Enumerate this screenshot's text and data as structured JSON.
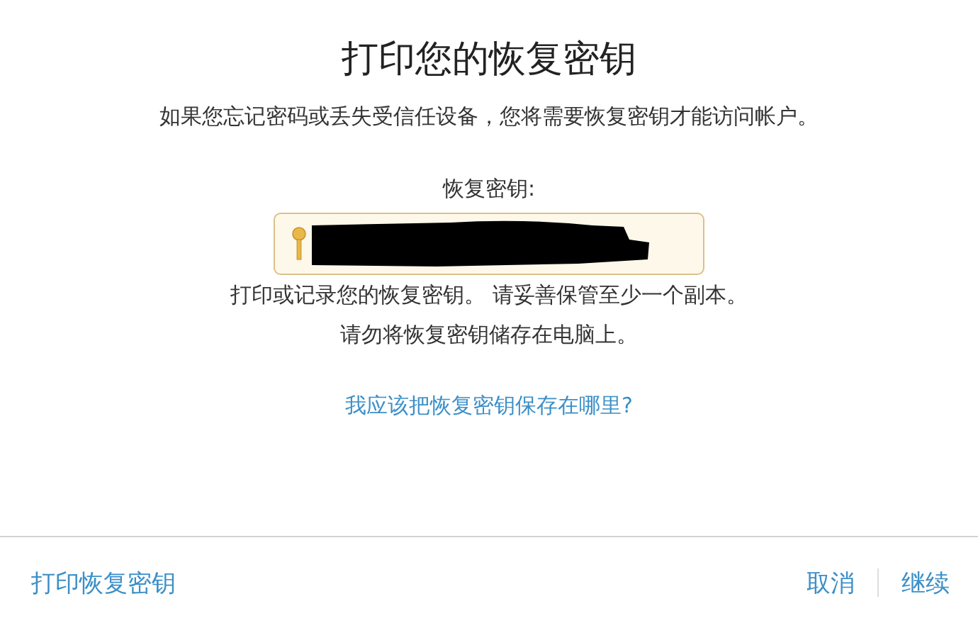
{
  "title": "打印您的恢复密钥",
  "subtitle": "如果您忘记密码或丢失受信任设备，您将需要恢复密钥才能访问帐户。",
  "key_label": "恢复密钥:",
  "instructions": [
    "打印或记录您的恢复密钥。 请妥善保管至少一个副本。",
    "请勿将恢复密钥储存在电脑上。"
  ],
  "help_link": "我应该把恢复密钥保存在哪里?",
  "footer": {
    "print_button": "打印恢复密钥",
    "cancel_button": "取消",
    "continue_button": "继续"
  }
}
